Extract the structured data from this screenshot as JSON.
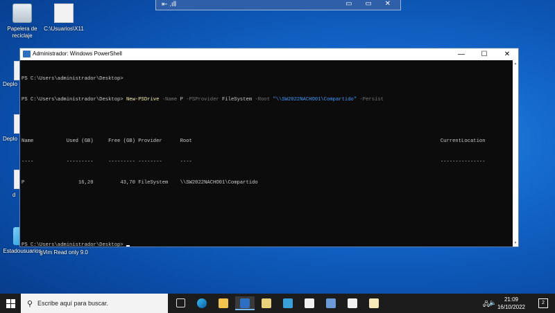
{
  "desktop": {
    "icons": [
      {
        "label": "Papelera de reciclaje"
      },
      {
        "label": "C:\\Usuarios\\X11"
      },
      {
        "label": "Estadousuarios"
      },
      {
        "label": "gVim Read only 9.0"
      }
    ],
    "partial_labels": [
      "Deplo",
      "Deplo",
      "d"
    ]
  },
  "remote_bar": {
    "left": "⇤ .ıll",
    "buttons": "▭ ▭ ✕"
  },
  "window": {
    "title": "Administrador: Windows PowerShell",
    "minimize": "—",
    "maximize": "☐",
    "close": "✕"
  },
  "console": {
    "line1": "PS C:\\Users\\administrador\\Desktop>",
    "cmd_prompt": "PS C:\\Users\\administrador\\Desktop> ",
    "cmd_name": "New-PSDrive",
    "p_name": " -Name ",
    "v_name": "P",
    "p_provider": " -PSProvider ",
    "v_provider": "FileSystem",
    "p_root": " -Root ",
    "v_root": "\"\\\\SW2022NACHO01\\Compartido\"",
    "p_persist": " -Persist",
    "header": "Name           Used (GB)     Free (GB) Provider      Root                                                                                   CurrentLocation",
    "underline": "----           ---------     --------- --------      ----                                                                                   ---------------",
    "row": "P                  16,20         43,70 FileSystem    \\\\SW2022NACHO01\\Compartido",
    "final_prompt": "PS C:\\Users\\administrador\\Desktop> "
  },
  "taskbar": {
    "search_placeholder": "Escribe aquí para buscar.",
    "time": "21:09",
    "date": "16/10/2022",
    "notifications": "2"
  }
}
